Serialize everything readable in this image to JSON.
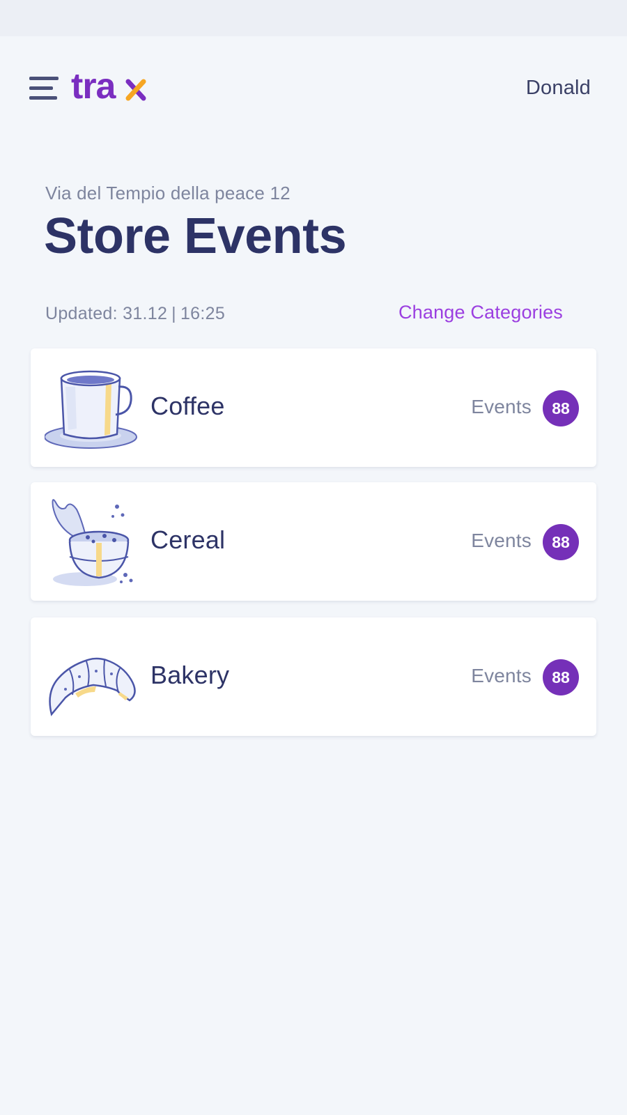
{
  "header": {
    "logo_text": "trax",
    "user_name": "Donald"
  },
  "store": {
    "address": "Via del Tempio della peace 12",
    "title": "Store Events",
    "updated_label": "Updated: 31.12",
    "updated_time": "16:25",
    "change_categories_label": "Change Categories"
  },
  "categories": [
    {
      "name": "Coffee",
      "events_label": "Events",
      "events_count": "88",
      "icon": "coffee-cup-icon"
    },
    {
      "name": "Cereal",
      "events_label": "Events",
      "events_count": "88",
      "icon": "cereal-bowl-icon"
    },
    {
      "name": "Bakery",
      "events_label": "Events",
      "events_count": "88",
      "icon": "croissant-icon"
    }
  ],
  "colors": {
    "brand_purple": "#7a2ec0",
    "brand_orange": "#f6a623",
    "accent_link": "#9b3fe0",
    "badge": "#7530b8",
    "title_text": "#2d3366",
    "background": "#f3f6fa"
  }
}
